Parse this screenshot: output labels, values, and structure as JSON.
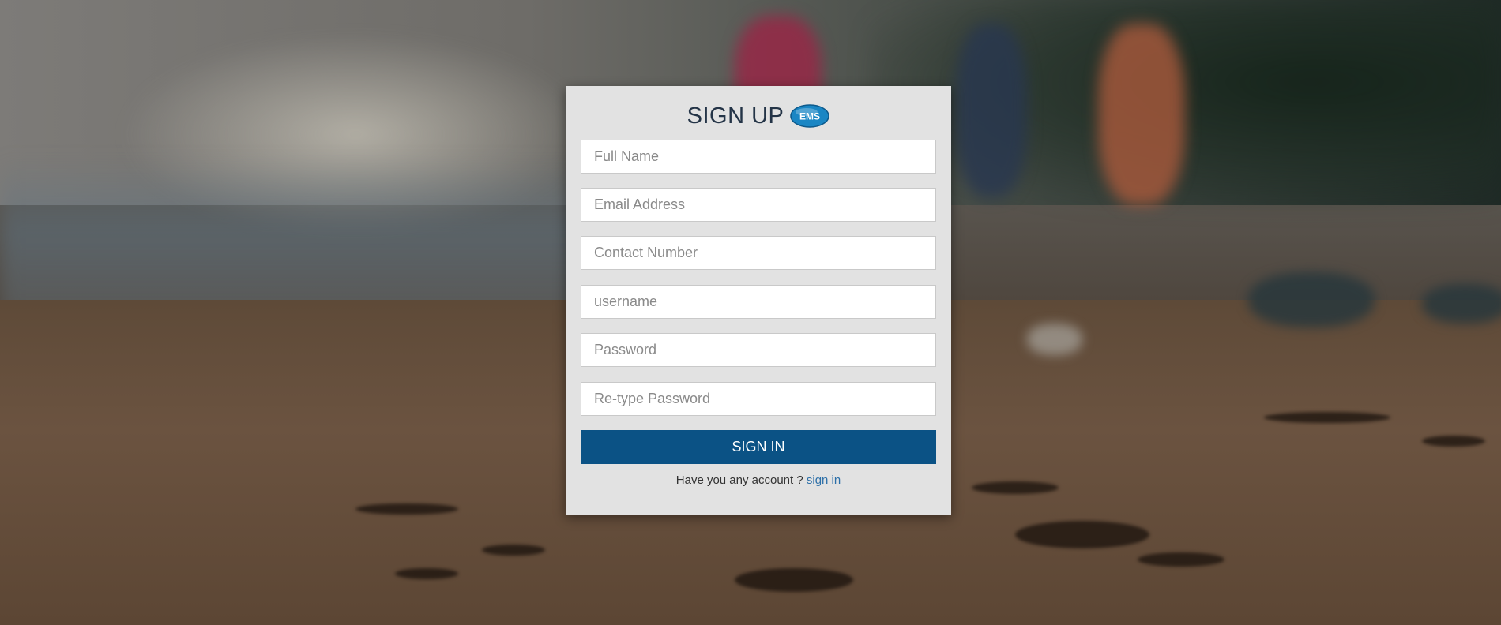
{
  "form": {
    "title": "SIGN UP",
    "logo_text": "EMS",
    "fields": [
      {
        "placeholder": "Full Name",
        "value": ""
      },
      {
        "placeholder": "Email Address",
        "value": ""
      },
      {
        "placeholder": "Contact Number",
        "value": ""
      },
      {
        "placeholder": "username",
        "value": ""
      },
      {
        "placeholder": "Password",
        "value": ""
      },
      {
        "placeholder": "Re-type Password",
        "value": ""
      }
    ],
    "submit_label": "SIGN IN",
    "footer_text": "Have you any account ? ",
    "footer_link": "sign in"
  },
  "colors": {
    "card_background": "#e2e2e2",
    "title": "#243447",
    "button": "#0b5285",
    "link": "#2c6fa8",
    "logo": "#1a86c4"
  }
}
